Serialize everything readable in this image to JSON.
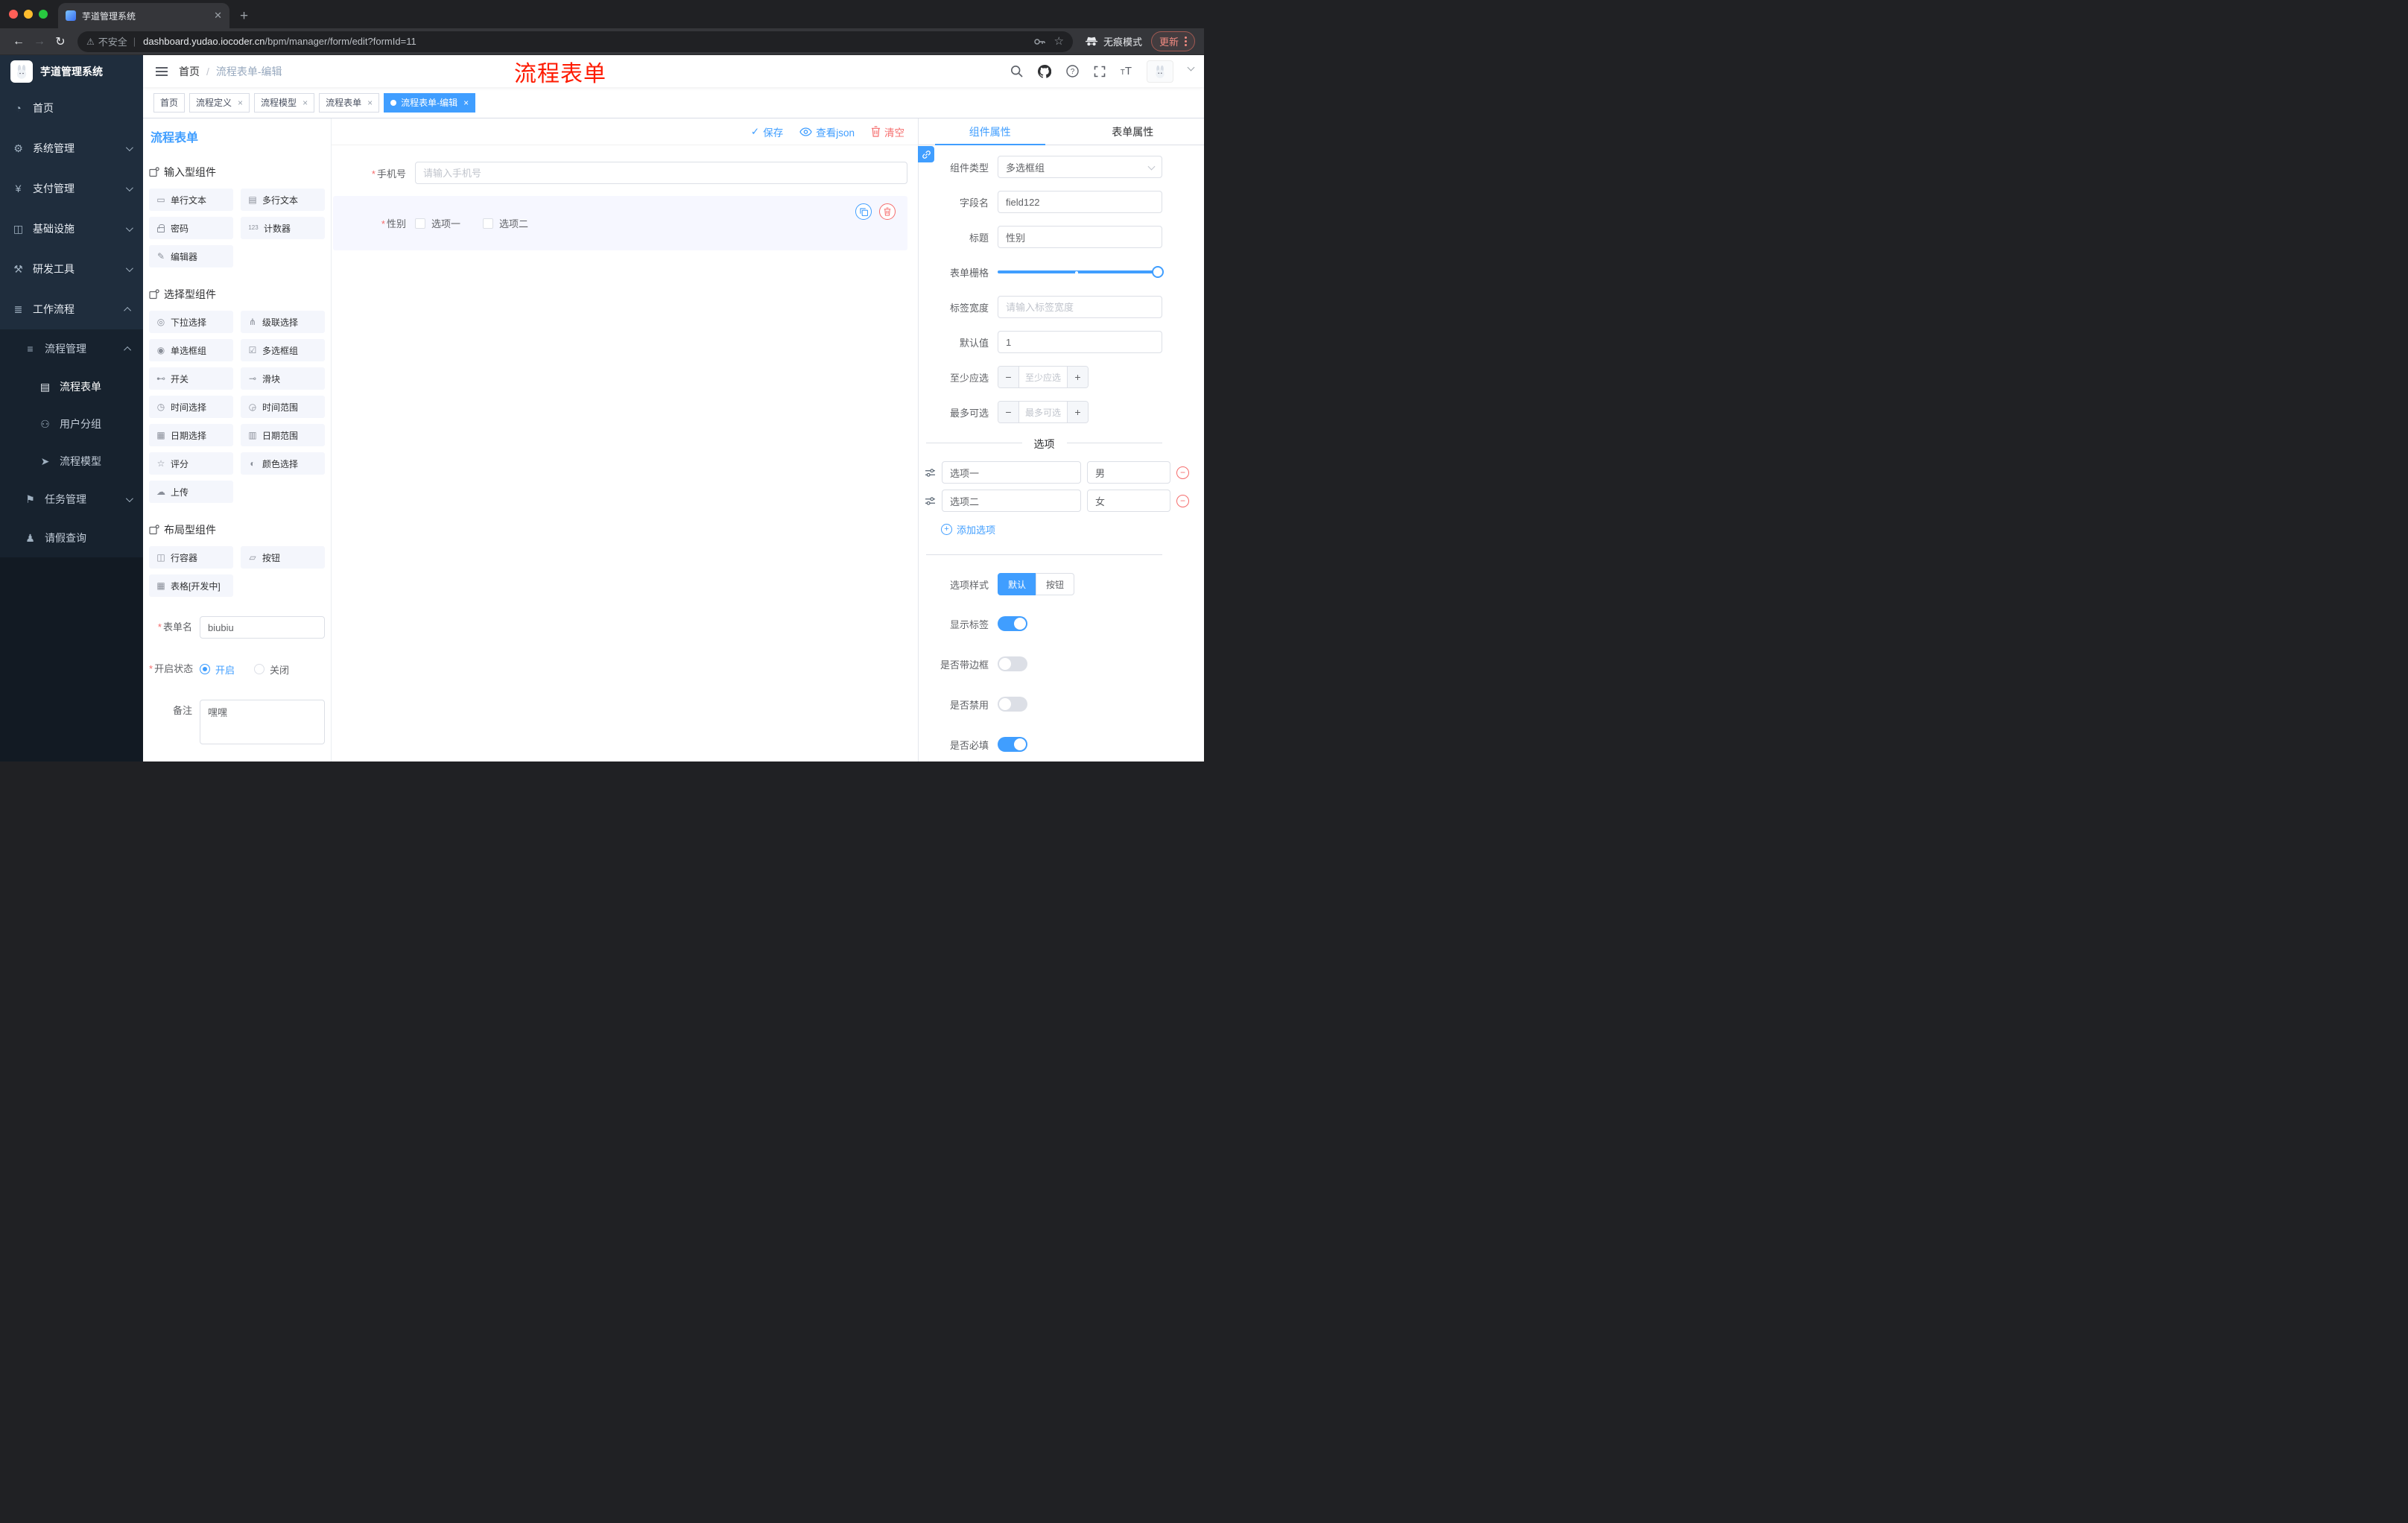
{
  "colors": {
    "accent": "#409eff",
    "danger": "#f56c6c",
    "annotation": "#fe1a00"
  },
  "browser": {
    "tab_title": "芋道管理系统",
    "security_label": "不安全",
    "url_domain": "dashboard.yudao.iocoder.cn",
    "url_path": "/bpm/manager/form/edit?formId=11",
    "incognito_label": "无痕模式",
    "update_label": "更新"
  },
  "sidebar": {
    "logo_title": "芋道管理系统",
    "home": "首页",
    "system": "系统管理",
    "pay": "支付管理",
    "infra": "基础设施",
    "devtool": "研发工具",
    "workflow": "工作流程",
    "process_mgmt": "流程管理",
    "process_form": "流程表单",
    "user_group": "用户分组",
    "process_model": "流程模型",
    "task_mgmt": "任务管理",
    "leave_query": "请假查询"
  },
  "header": {
    "breadcrumb_home": "首页",
    "breadcrumb_sep": "/",
    "breadcrumb_current": "流程表单-编辑",
    "annotation": "流程表单"
  },
  "tags": [
    {
      "label": "首页"
    },
    {
      "label": "流程定义"
    },
    {
      "label": "流程模型"
    },
    {
      "label": "流程表单"
    },
    {
      "label": "流程表单-编辑"
    }
  ],
  "panel_title": "流程表单",
  "toolbar_actions": {
    "save": "保存",
    "view_json": "查看json",
    "clear": "清空"
  },
  "component_groups": [
    {
      "title": "输入型组件",
      "items": [
        "单行文本",
        "多行文本",
        "密码",
        "计数器",
        "编辑器"
      ]
    },
    {
      "title": "选择型组件",
      "items": [
        "下拉选择",
        "级联选择",
        "单选框组",
        "多选框组",
        "开关",
        "滑块",
        "时间选择",
        "时间范围",
        "日期选择",
        "日期范围",
        "评分",
        "颜色选择",
        "上传"
      ]
    },
    {
      "title": "布局型组件",
      "items": [
        "行容器",
        "按钮",
        "表格[开发中]"
      ]
    }
  ],
  "form_meta": {
    "name_label": "表单名",
    "name_value": "biubiu",
    "status_label": "开启状态",
    "status_on": "开启",
    "status_off": "关闭",
    "remark_label": "备注",
    "remark_value": "嘿嘿"
  },
  "canvas": {
    "phone_label": "手机号",
    "phone_placeholder": "请输入手机号",
    "gender_label": "性别",
    "gender_options": [
      {
        "label": "选项一"
      },
      {
        "label": "选项二"
      }
    ]
  },
  "props": {
    "tab_component": "组件属性",
    "tab_form": "表单属性",
    "rows": {
      "type_label": "组件类型",
      "type_value": "多选框组",
      "field_label": "字段名",
      "field_value": "field122",
      "title_label": "标题",
      "title_value": "性别",
      "grid_label": "表单栅格",
      "labelw_label": "标签宽度",
      "labelw_placeholder": "请输入标签宽度",
      "default_label": "默认值",
      "default_value": "1",
      "min_label": "至少应选",
      "min_placeholder": "至少应选",
      "max_label": "最多可选",
      "max_placeholder": "最多可选"
    },
    "options_title": "选项",
    "options": [
      {
        "label": "选项一",
        "value": "男"
      },
      {
        "label": "选项二",
        "value": "女"
      }
    ],
    "add_option": "添加选项",
    "style_label": "选项样式",
    "style_default": "默认",
    "style_button": "按钮",
    "switch_rows": [
      {
        "label": "显示标签",
        "on": true
      },
      {
        "label": "是否带边框",
        "on": false
      },
      {
        "label": "是否禁用",
        "on": false
      },
      {
        "label": "是否必填",
        "on": true
      }
    ]
  }
}
